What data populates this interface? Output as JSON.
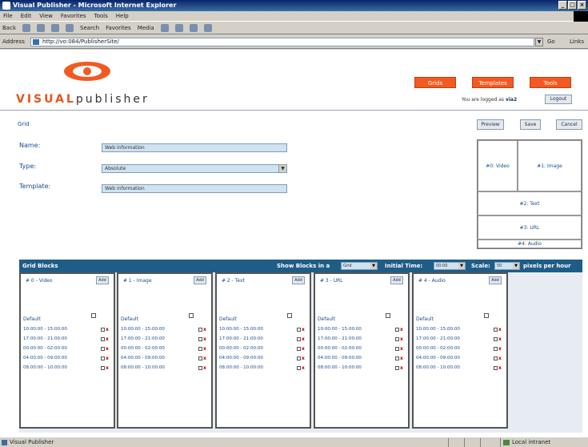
{
  "window": {
    "title": "Visual Publisher - Microsoft Internet Explorer"
  },
  "menu": [
    "File",
    "Edit",
    "View",
    "Favorites",
    "Tools",
    "Help"
  ],
  "toolbar": {
    "back": "Back",
    "search": "Search",
    "favorites": "Favorites",
    "media": "Media"
  },
  "address": {
    "label": "Address",
    "url": "http://vo:084/PublisherSite/",
    "go": "Go",
    "links": "Links"
  },
  "brand": {
    "prefix": "VISUAL",
    "suffix": "publisher"
  },
  "nav": [
    {
      "label": "Grids"
    },
    {
      "label": "Templates"
    },
    {
      "label": "Tools"
    }
  ],
  "user": {
    "logged_in_prefix": "You are logged as",
    "username": "via2",
    "logout": "Logout"
  },
  "breadcrumb": "Grid",
  "actions": {
    "preview": "Preview",
    "save": "Save",
    "cancel": "Cancel"
  },
  "form": {
    "name_label": "Name:",
    "name_value": "Web information",
    "type_label": "Type:",
    "type_value": "Absolute",
    "template_label": "Template:",
    "template_value": "Web information"
  },
  "layout": {
    "video": "#0: Video",
    "image": "#1: Image",
    "text": "#2: Text",
    "url": "#3: URL",
    "audio": "#4: Audio"
  },
  "grid_blocks": {
    "title": "Grid Blocks",
    "show_label": "Show Blocks in a",
    "show_value": "Grid",
    "initial_time_label": "Initial Time:",
    "initial_time_value": "00:00",
    "scale_label": "Scale:",
    "scale_value": "50",
    "per_hour": "pixels per hour",
    "columns": [
      {
        "title": "# 0 - Video",
        "add": "Add",
        "default": "Default",
        "rows": [
          "10:00:00 - 15:00:00",
          "17:00:00 - 21:00:00",
          "00:00:00 - 02:00:00",
          "04:00:00 - 09:00:00",
          "08:00:00 - 10:00:00"
        ]
      },
      {
        "title": "# 1 - Image",
        "add": "Add",
        "default": "Default",
        "rows": [
          "10:00:00 - 15:00:00",
          "17:00:00 - 21:00:00",
          "00:00:00 - 02:00:00",
          "04:00:00 - 09:00:00",
          "08:00:00 - 10:00:00"
        ]
      },
      {
        "title": "# 2 - Text",
        "add": "Add",
        "default": "Default",
        "rows": [
          "10:00:00 - 15:00:00",
          "17:00:00 - 21:00:00",
          "00:00:00 - 02:00:00",
          "04:00:00 - 09:00:00",
          "08:00:00 - 10:00:00"
        ]
      },
      {
        "title": "# 3 - URL",
        "add": "Add",
        "default": "Default",
        "rows": [
          "10:00:00 - 15:00:00",
          "17:00:00 - 21:00:00",
          "00:00:00 - 02:00:00",
          "04:00:00 - 09:00:00",
          "08:00:00 - 10:00:00"
        ]
      },
      {
        "title": "# 4 - Audio",
        "add": "Add",
        "default": "Default",
        "rows": [
          "10:00:00 - 15:00:00",
          "17:00:00 - 21:00:00",
          "00:00:00 - 02:00:00",
          "04:00:00 - 09:00:00",
          "08:00:00 - 10:00:00"
        ]
      }
    ]
  },
  "status": {
    "left": "Visual Publisher",
    "zone": "Local intranet"
  },
  "colors": {
    "accent": "#f15a22",
    "header": "#1f5d87",
    "link": "#1b4b8c"
  }
}
